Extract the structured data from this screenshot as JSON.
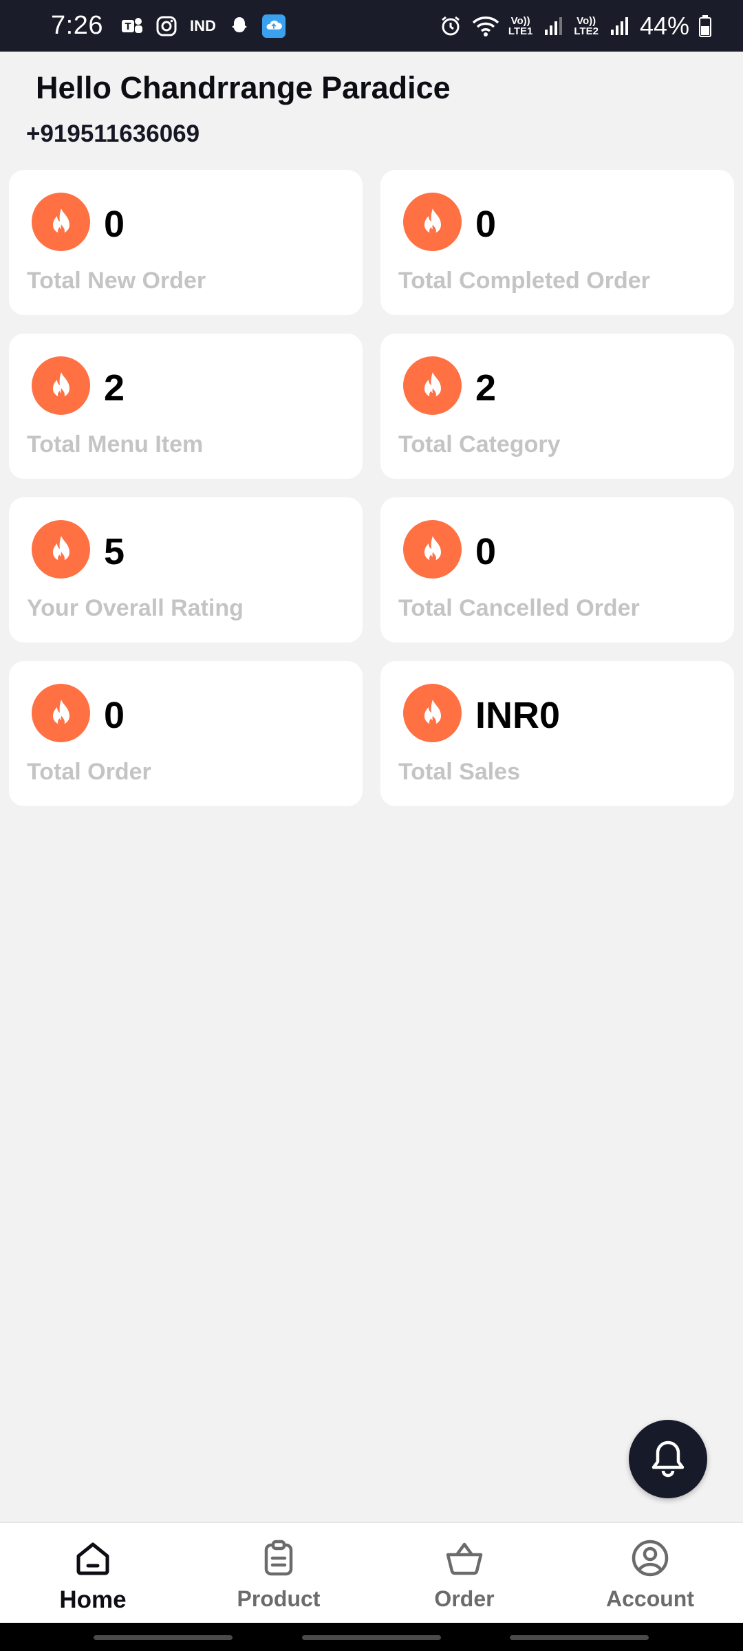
{
  "status_bar": {
    "time": "7:26",
    "battery": "44%",
    "lte1": "LTE1",
    "lte2": "LTE2",
    "vo": "Vo))",
    "carrier_badge": "IND"
  },
  "header": {
    "greeting": "Hello Chandrrange Paradice",
    "phone": "+919511636069"
  },
  "stats": [
    {
      "value": "0",
      "label": "Total New Order",
      "icon": "flame-icon"
    },
    {
      "value": "0",
      "label": "Total Completed Order",
      "icon": "flame-icon"
    },
    {
      "value": "2",
      "label": "Total Menu Item",
      "icon": "flame-icon"
    },
    {
      "value": "2",
      "label": "Total Category",
      "icon": "flame-icon"
    },
    {
      "value": "5",
      "label": "Your Overall Rating",
      "icon": "flame-icon"
    },
    {
      "value": "0",
      "label": "Total Cancelled Order",
      "icon": "flame-icon"
    },
    {
      "value": "0",
      "label": "Total Order",
      "icon": "flame-icon"
    },
    {
      "value": "INR0",
      "label": "Total Sales",
      "icon": "flame-icon"
    }
  ],
  "bottom_nav": [
    {
      "label": "Home",
      "icon": "home-icon",
      "active": true
    },
    {
      "label": "Product",
      "icon": "clipboard-icon",
      "active": false
    },
    {
      "label": "Order",
      "icon": "basket-icon",
      "active": false
    },
    {
      "label": "Account",
      "icon": "user-circle-icon",
      "active": false
    }
  ],
  "colors": {
    "accent": "#ff7043",
    "dark": "#171a28",
    "background": "#f2f2f2",
    "label_muted": "#c4c4c4"
  }
}
